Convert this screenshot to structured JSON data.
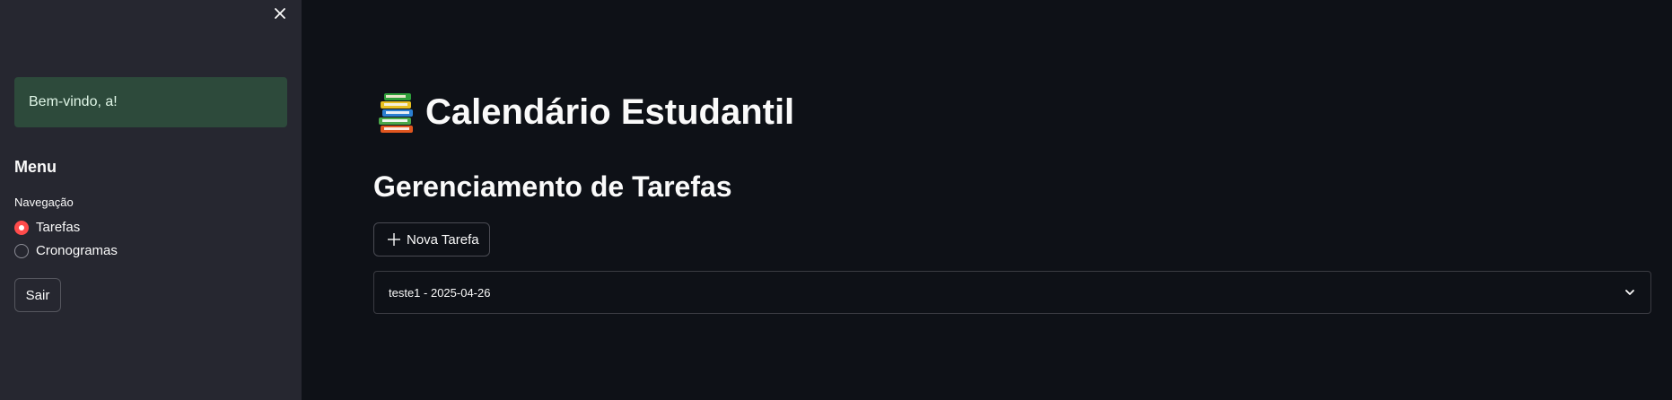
{
  "sidebar": {
    "welcome_message": "Bem-vindo, a!",
    "menu_title": "Menu",
    "navigation_label": "Navegação",
    "nav_options": [
      {
        "label": "Tarefas",
        "selected": true
      },
      {
        "label": "Cronogramas",
        "selected": false
      }
    ],
    "logout_label": "Sair",
    "close_icon": "close-icon"
  },
  "main": {
    "page_title": "Calendário Estudantil",
    "title_icon": "books-icon",
    "section_title": "Gerenciamento de Tarefas",
    "new_task_label": "Nova Tarefa",
    "tasks": [
      {
        "label": "teste1 - 2025-04-26",
        "expanded": false
      }
    ]
  },
  "colors": {
    "app_background": "#0e1117",
    "sidebar_background": "#262730",
    "success_background": "#2d4a3b",
    "accent": "#ff4b4b"
  }
}
